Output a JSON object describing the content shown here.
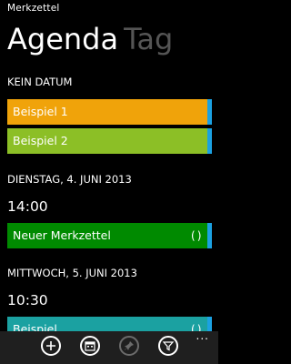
{
  "app": {
    "title": "Merkzettel"
  },
  "pivot": {
    "active": "Agenda",
    "inactive": "Tag"
  },
  "sections": {
    "no_date": {
      "header": "KEIN DATUM",
      "items": [
        {
          "label": "Beispiel 1",
          "color": "#f0a30a"
        },
        {
          "label": "Beispiel 2",
          "color": "#8cbf26"
        }
      ]
    },
    "tuesday": {
      "header": "DIENSTAG, 4. JUNI 2013",
      "time": "14:00",
      "items": [
        {
          "label": "Neuer Merkzettel",
          "color": "#008a00",
          "repeat_icon": "repeat-icon"
        }
      ]
    },
    "wednesday": {
      "header": "MITTWOCH, 5. JUNI 2013",
      "time": "10:30",
      "items": [
        {
          "label": "Beispiel",
          "color": "#1ba1a1",
          "repeat_icon": "repeat-icon"
        }
      ]
    }
  },
  "appbar": {
    "buttons": [
      "add-icon",
      "calendar-icon",
      "pin-icon",
      "filter-icon"
    ],
    "more": "..."
  }
}
